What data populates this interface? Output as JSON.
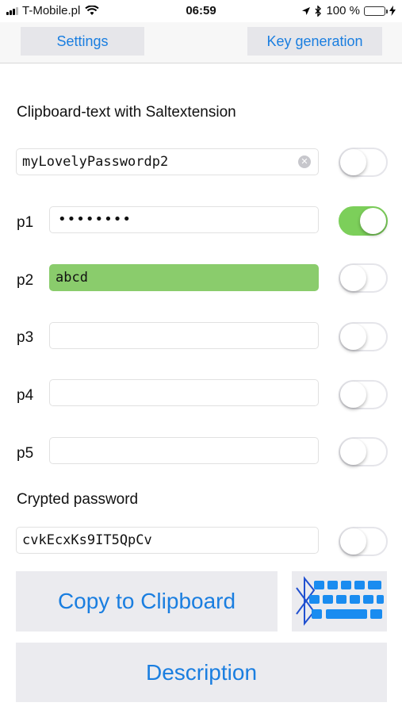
{
  "status": {
    "carrier": "T-Mobile.pl",
    "time": "06:59",
    "battery": "100 %",
    "battery_fill": 1.0,
    "icons": [
      "signal-icon",
      "wifi-icon",
      "location-icon",
      "bluetooth-icon",
      "battery-icon",
      "charging-icon"
    ]
  },
  "nav": {
    "settings_label": "Settings",
    "keygen_label": "Key generation"
  },
  "clipboard": {
    "title": "Clipboard-text with Saltextension",
    "value": "myLovelyPasswordp2",
    "toggle_on": false
  },
  "params": [
    {
      "label": "p1",
      "value": "••••••••",
      "highlight": false,
      "toggle_on": true
    },
    {
      "label": "p2",
      "value": "abcd",
      "highlight": true,
      "toggle_on": false
    },
    {
      "label": "p3",
      "value": "",
      "highlight": false,
      "toggle_on": false
    },
    {
      "label": "p4",
      "value": "",
      "highlight": false,
      "toggle_on": false
    },
    {
      "label": "p5",
      "value": "",
      "highlight": false,
      "toggle_on": false
    }
  ],
  "crypted": {
    "title": "Crypted password",
    "value": "cvkEcxKs9IT5QpCv",
    "toggle_on": false
  },
  "buttons": {
    "copy_label": "Copy to Clipboard",
    "description_label": "Description",
    "keyboard_icon": "bluetooth-keyboard-icon"
  },
  "colors": {
    "accent": "#1a7ee0",
    "toggle_on": "#7ccf5a",
    "highlight_field": "#8acc6c",
    "button_bg": "#ebebef"
  }
}
